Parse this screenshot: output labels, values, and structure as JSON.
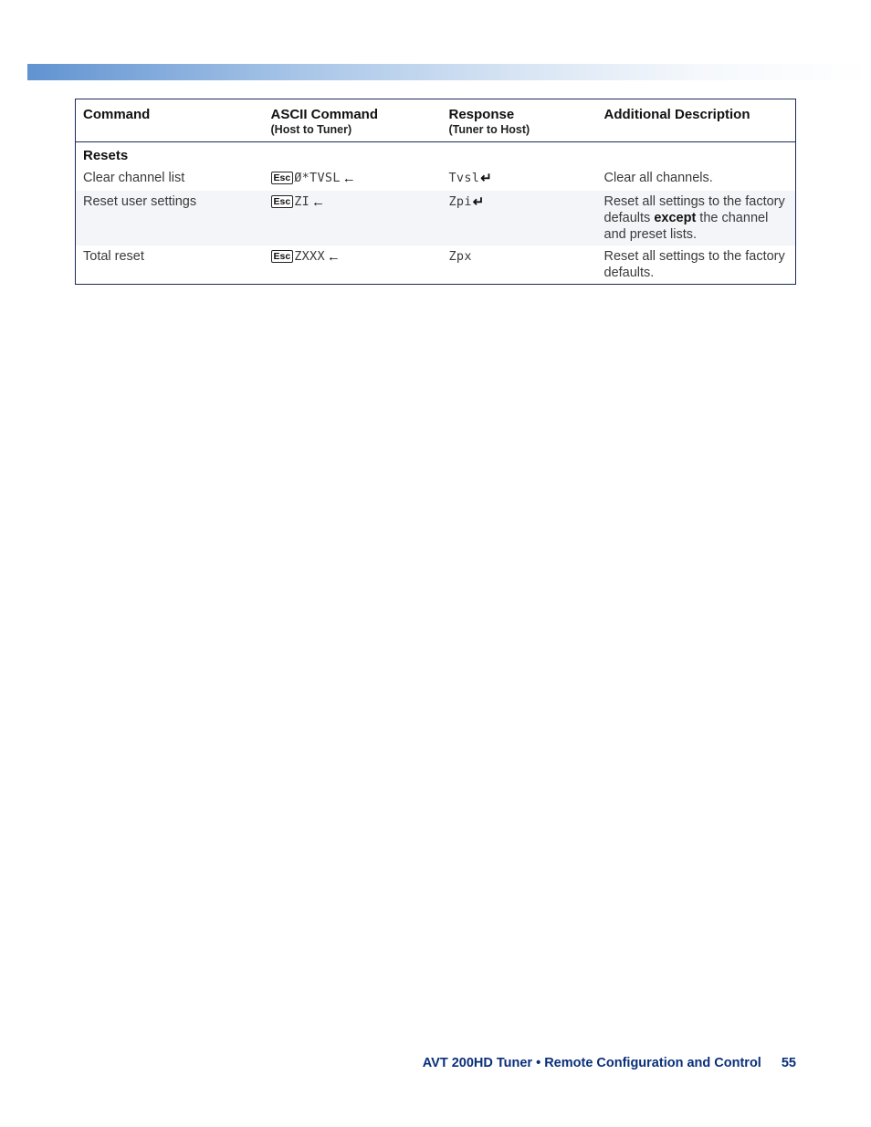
{
  "header": {
    "col1": "Command",
    "col2": "ASCII Command",
    "col2_sub": "(Host to Tuner)",
    "col3": "Response",
    "col3_sub": "(Tuner to Host)",
    "col4": "Additional Description"
  },
  "section": "Resets",
  "key_esc": "Esc",
  "sym_arrow": "←",
  "sym_return": "↵",
  "rows": [
    {
      "command": "Clear channel list",
      "ascii_after": "Ø*TVSL",
      "ascii_has_arrow": true,
      "response": "Tvsl",
      "response_has_return": true,
      "desc_pre": "Clear all channels.",
      "desc_bold": "",
      "desc_post": ""
    },
    {
      "command": "Reset user settings",
      "ascii_after": "ZI",
      "ascii_has_arrow": true,
      "response": "Zpi",
      "response_has_return": true,
      "desc_pre": "Reset all settings to the  factory defaults ",
      "desc_bold": "except",
      "desc_post": " the channel and preset lists."
    },
    {
      "command": "Total reset",
      "ascii_after": "ZXXX",
      "ascii_has_arrow": true,
      "response": "Zpx",
      "response_has_return": false,
      "desc_pre": "Reset all settings to the factory defaults.",
      "desc_bold": "",
      "desc_post": ""
    }
  ],
  "footer": {
    "text": "AVT 200HD Tuner • Remote Configuration and Control",
    "page": "55"
  }
}
